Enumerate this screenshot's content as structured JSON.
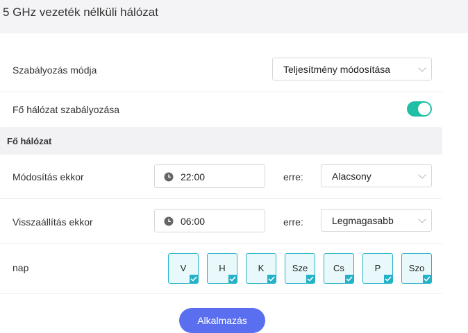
{
  "header": {
    "title": "5 GHz vezeték nélküli hálózat"
  },
  "regulation_mode": {
    "label": "Szabályozás módja",
    "value": "Teljesítmény módosítása"
  },
  "main_network_toggle": {
    "label": "Fő hálózat szabályozása",
    "enabled": true
  },
  "section": {
    "title": "Fő hálózat"
  },
  "modify_at": {
    "label": "Módosítás ekkor",
    "time": "22:00",
    "to_label": "erre:",
    "level": "Alacsony"
  },
  "restore_at": {
    "label": "Visszaállítás ekkor",
    "time": "06:00",
    "to_label": "erre:",
    "level": "Legmagasabb"
  },
  "days": {
    "label": "nap",
    "items": [
      {
        "label": "V",
        "checked": true
      },
      {
        "label": "H",
        "checked": true
      },
      {
        "label": "K",
        "checked": true
      },
      {
        "label": "Sze",
        "checked": true
      },
      {
        "label": "Cs",
        "checked": true
      },
      {
        "label": "P",
        "checked": true
      },
      {
        "label": "Szo",
        "checked": true
      }
    ]
  },
  "apply_button": {
    "label": "Alkalmazás"
  },
  "colors": {
    "accent": "#1ebfa4",
    "day_border": "#24b2c8",
    "button": "#5a6ff0"
  }
}
